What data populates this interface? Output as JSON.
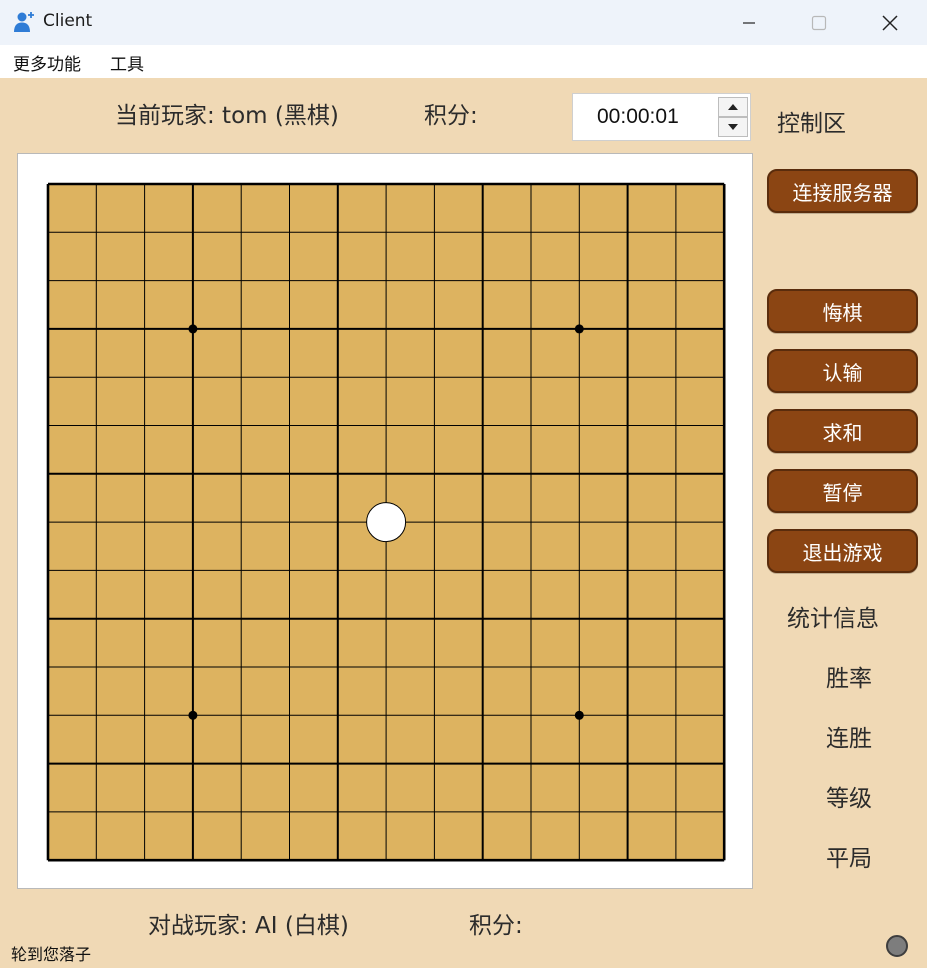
{
  "window": {
    "title": "Client",
    "controls": {
      "minimize": "minimize-icon",
      "maximize": "maximize-icon",
      "close": "close-icon"
    }
  },
  "menu": {
    "items": [
      "更多功能",
      "工具"
    ]
  },
  "header": {
    "current_player": "当前玩家: tom (黑棋)",
    "current_score_label": "积分:",
    "timer": "00:00:01",
    "control_area_label": "控制区"
  },
  "board": {
    "size": 15,
    "star_points": [
      [
        3,
        3
      ],
      [
        3,
        11
      ],
      [
        11,
        3
      ],
      [
        11,
        11
      ]
    ],
    "stones": [
      {
        "row": 7,
        "col": 7,
        "color": "white"
      }
    ],
    "colors": {
      "board": "#ddb360",
      "line": "#000000",
      "white_stone": "#ffffff"
    }
  },
  "controls": {
    "connect_label": "连接服务器",
    "undo_label": "悔棋",
    "resign_label": "认输",
    "draw_label": "求和",
    "pause_label": "暂停",
    "exit_label": "退出游戏"
  },
  "stats": {
    "title": "统计信息",
    "win_rate_label": "胜率",
    "streak_label": "连胜",
    "level_label": "等级",
    "draw_label": "平局"
  },
  "footer": {
    "opponent": "对战玩家: AI (白棋)",
    "opponent_score_label": "积分:"
  },
  "status": {
    "message": "轮到您落子"
  },
  "colors": {
    "background": "#f0d9b5",
    "button": "#8b4513",
    "button_border": "#5a2c0c"
  }
}
